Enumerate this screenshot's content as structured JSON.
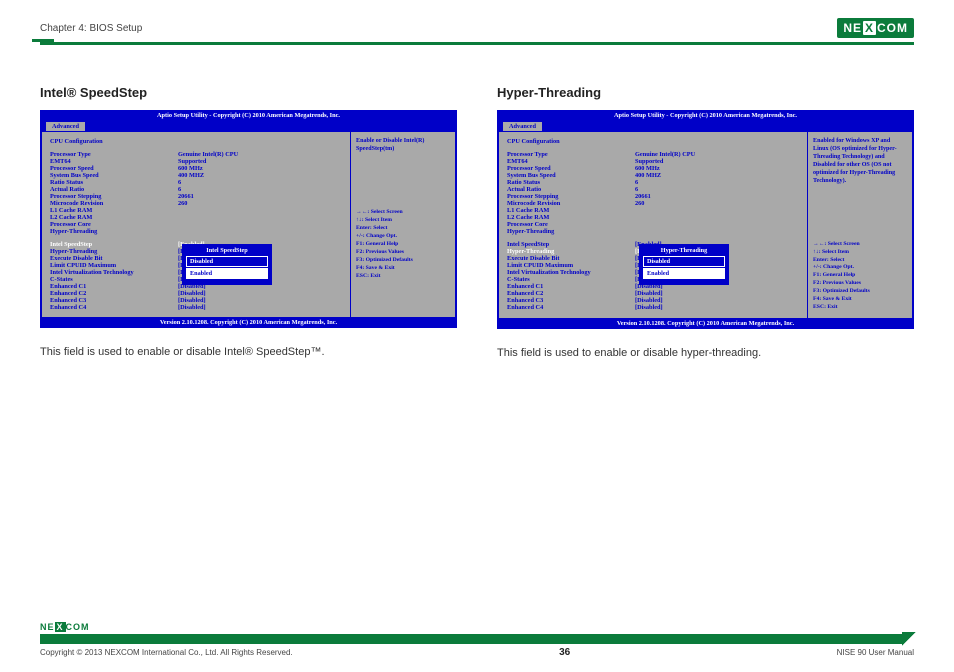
{
  "header": {
    "chapter": "Chapter 4: BIOS Setup",
    "logo_left": "NE",
    "logo_mid": "X",
    "logo_right": "COM"
  },
  "left": {
    "title": "Intel® SpeedStep",
    "bios": {
      "top": "Aptio Setup Utility - Copyright (C) 2010 American Megatrends, Inc.",
      "tab": "Advanced",
      "cfg": "CPU Configuration",
      "rows": [
        {
          "l": "Processor Type",
          "v": "Genuine Intel(R) CPU"
        },
        {
          "l": "EMT64",
          "v": "Supported"
        },
        {
          "l": "Processor Speed",
          "v": "600 MHz"
        },
        {
          "l": "System Bus Speed",
          "v": "400 MHZ"
        },
        {
          "l": "Ratio Status",
          "v": "6"
        },
        {
          "l": "Actual Ratio",
          "v": "6"
        },
        {
          "l": "Processor Stepping",
          "v": "20661"
        },
        {
          "l": "Microcode Revision",
          "v": "260"
        },
        {
          "l": "L1 Cache RAM",
          "v": ""
        },
        {
          "l": "L2 Cache RAM",
          "v": ""
        },
        {
          "l": "Processor Core",
          "v": ""
        },
        {
          "l": "Hyper-Threading",
          "v": ""
        }
      ],
      "opts": [
        {
          "l": "Intel SpeedStep",
          "v": "[Enabled]",
          "hl": true
        },
        {
          "l": "Hyper-Threading",
          "v": "[Enabled]"
        },
        {
          "l": "Execute Disable Bit",
          "v": "[Enabled]"
        },
        {
          "l": "Limit CPUID Maximum",
          "v": "[Disabled]"
        },
        {
          "l": "Intel Virtualization Technology",
          "v": "[Disabled]"
        },
        {
          "l": "C-States",
          "v": "[Enabled]"
        },
        {
          "l": "Enhanced C1",
          "v": "[Disabled]"
        },
        {
          "l": "Enhanced C2",
          "v": "[Disabled]"
        },
        {
          "l": "Enhanced C3",
          "v": "[Disabled]"
        },
        {
          "l": "Enhanced C4",
          "v": "[Disabled]"
        }
      ],
      "popup": {
        "title": "Intel SpeedStep",
        "o1": "Disabled",
        "o2": "Enabled"
      },
      "side_top": "Enable or Disable Intel(R) SpeedStep(tm)",
      "help": [
        "→←: Select Screen",
        "↑↓: Select Item",
        "Enter: Select",
        "+/-: Change Opt.",
        "F1: General Help",
        "F2: Previous Values",
        "F3: Optimized Defaults",
        "F4: Save & Exit",
        "ESC: Exit"
      ],
      "bottom": "Version 2.10.1208. Copyright (C) 2010 American Megatrends, Inc."
    },
    "desc": "This field is used to enable or disable Intel® SpeedStep™."
  },
  "right": {
    "title": "Hyper-Threading",
    "bios": {
      "top": "Aptio Setup Utility - Copyright (C) 2010 American Megatrends, Inc.",
      "tab": "Advanced",
      "cfg": "CPU Configuration",
      "rows": [
        {
          "l": "Processor Type",
          "v": "Genuine Intel(R) CPU"
        },
        {
          "l": "EMT64",
          "v": "Supported"
        },
        {
          "l": "Processor Speed",
          "v": "600 MHz"
        },
        {
          "l": "System Bus Speed",
          "v": "400 MHZ"
        },
        {
          "l": "Ratio Status",
          "v": "6"
        },
        {
          "l": "Actual Ratio",
          "v": "6"
        },
        {
          "l": "Processor Stepping",
          "v": "20661"
        },
        {
          "l": "Microcode Revision",
          "v": "260"
        },
        {
          "l": "L1 Cache RAM",
          "v": ""
        },
        {
          "l": "L2 Cache RAM",
          "v": ""
        },
        {
          "l": "Processor Core",
          "v": ""
        },
        {
          "l": "Hyper-Threading",
          "v": ""
        }
      ],
      "opts": [
        {
          "l": "Intel SpeedStep",
          "v": "[Enabled]"
        },
        {
          "l": "Hyper-Threading",
          "v": "[Enabled]",
          "hl": true
        },
        {
          "l": "Execute Disable Bit",
          "v": "[Enabled]"
        },
        {
          "l": "Limit CPUID Maximum",
          "v": "[Disabled]"
        },
        {
          "l": "Intel Virtualization Technology",
          "v": "[Disabled]"
        },
        {
          "l": "C-States",
          "v": "[Enabled]"
        },
        {
          "l": "Enhanced C1",
          "v": "[Disabled]"
        },
        {
          "l": "Enhanced C2",
          "v": "[Disabled]"
        },
        {
          "l": "Enhanced C3",
          "v": "[Disabled]"
        },
        {
          "l": "Enhanced C4",
          "v": "[Disabled]"
        }
      ],
      "popup": {
        "title": "Hyper-Threading",
        "o1": "Disabled",
        "o2": "Enabled"
      },
      "side_top": "Enabled for Windows XP and Linux (OS optimized for Hyper-Threading Technology) and Disabled for other OS (OS not optimized for Hyper-Threading Technology).",
      "help": [
        "→←: Select Screen",
        "↑↓: Select Item",
        "Enter: Select",
        "+/-: Change Opt.",
        "F1: General Help",
        "F2: Previous Values",
        "F3: Optimized Defaults",
        "F4: Save & Exit",
        "ESC: Exit"
      ],
      "bottom": "Version 2.10.1208. Copyright (C) 2010 American Megatrends, Inc."
    },
    "desc": "This field is used to enable or disable hyper-threading."
  },
  "footer": {
    "copyright": "Copyright © 2013 NEXCOM International Co., Ltd. All Rights Reserved.",
    "page": "36",
    "manual": "NISE 90 User Manual"
  }
}
